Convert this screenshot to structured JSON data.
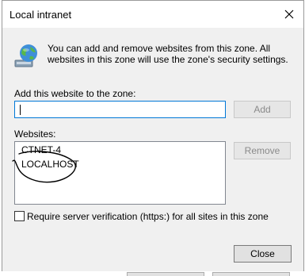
{
  "window": {
    "title": "Local intranet"
  },
  "info": {
    "text": "You can add and remove websites from this zone. All websites in this zone will use the zone's security settings."
  },
  "add": {
    "label": "Add this website to the zone:",
    "value": "",
    "button": "Add"
  },
  "websites": {
    "label": "Websites:",
    "items": [
      "CTNET-4",
      "LOCALHOST"
    ],
    "remove_button": "Remove"
  },
  "https": {
    "label": "Require server verification (https:) for all sites in this zone",
    "checked": false
  },
  "footer": {
    "close_button": "Close"
  },
  "colors": {
    "focus": "#0078d7",
    "client_bg": "#f0f0f0",
    "ink": "#000000"
  },
  "icons": [
    "close-icon",
    "globe-icon"
  ]
}
